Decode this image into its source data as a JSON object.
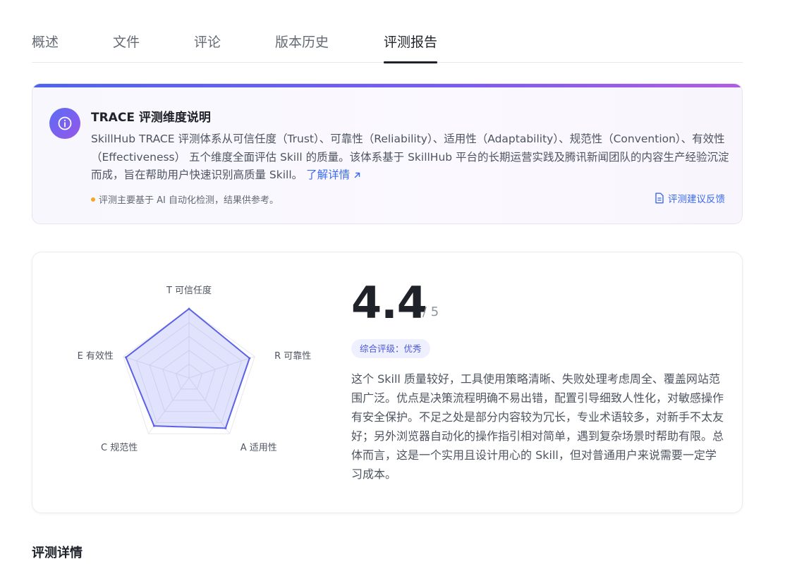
{
  "tabs": [
    {
      "label": "概述"
    },
    {
      "label": "文件"
    },
    {
      "label": "评论"
    },
    {
      "label": "版本历史"
    },
    {
      "label": "评测报告",
      "active": true
    }
  ],
  "info": {
    "title": "TRACE 评测维度说明",
    "description": "SkillHub TRACE 评测体系从可信任度（Trust）、可靠性（Reliability）、适用性（Adaptability）、规范性（Convention）、有效性（Effectiveness） 五个维度全面评估 Skill 的质量。该体系基于 SkillHub 平台的长期运营实践及腾讯新闻团队的内容生产经验沉淀而成，旨在帮助用户快速识别高质量 Skill。",
    "more_link": "了解详情",
    "note": "评测主要基于 AI 自动化检测，结果供参考。",
    "feedback": "评测建议反馈",
    "icon": "info-icon"
  },
  "score": {
    "value": "4.4",
    "max": "/ 5",
    "grade": "综合评级：优秀",
    "summary": "这个 Skill 质量较好，工具使用策略清晰、失败处理考虑周全、覆盖网站范围广泛。优点是决策流程明确不易出错，配置引导细致人性化，对敏感操作有安全保护。不足之处是部分内容较为冗长，专业术语较多，对新手不太友好；另外浏览器自动化的操作指引相对简单，遇到复杂场景时帮助有限。总体而言，这是一个实用且设计用心的 Skill，但对普通用户来说需要一定学习成本。"
  },
  "radar": {
    "max": 5,
    "dimensions": [
      {
        "label": "T 可信任度",
        "value": 5
      },
      {
        "label": "R 可靠性",
        "value": 4.6
      },
      {
        "label": "A 适用性",
        "value": 4.5
      },
      {
        "label": "C 规范性",
        "value": 4.3
      },
      {
        "label": "E 有效性",
        "value": 4.8
      }
    ],
    "colors": {
      "line": "#5b62e6",
      "fill": "rgba(120,128,240,0.22)",
      "grid": "#e6e8ee"
    }
  },
  "details": {
    "title": "评测详情"
  }
}
